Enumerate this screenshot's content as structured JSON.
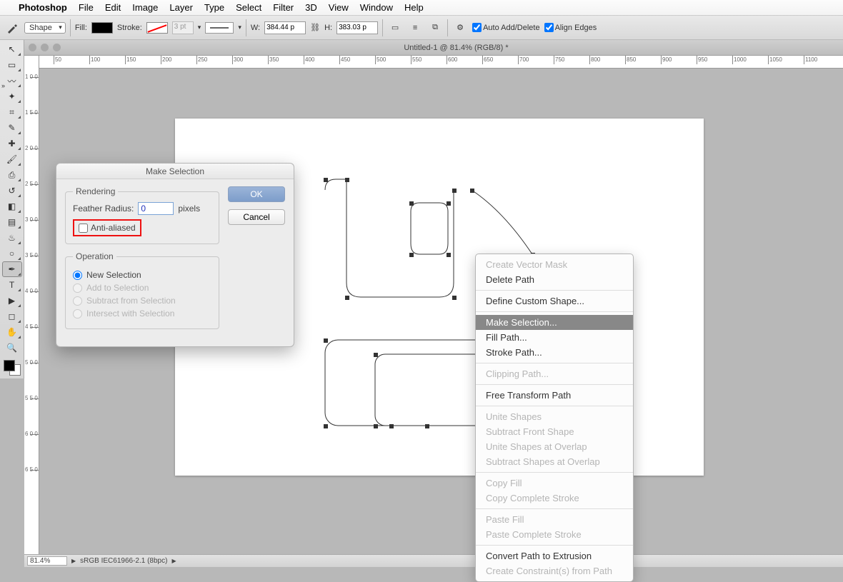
{
  "menubar": {
    "apple": "",
    "app": "Photoshop",
    "items": [
      "File",
      "Edit",
      "Image",
      "Layer",
      "Type",
      "Select",
      "Filter",
      "3D",
      "View",
      "Window",
      "Help"
    ]
  },
  "optbar": {
    "mode": "Shape",
    "fill_label": "Fill:",
    "stroke_label": "Stroke:",
    "stroke_w": "3 pt",
    "w_label": "W:",
    "w_val": "384.44 p",
    "h_label": "H:",
    "h_val": "383.03 p",
    "auto_add": "Auto Add/Delete",
    "align_edges": "Align Edges"
  },
  "tab": {
    "title": "Untitled-1 @ 81.4% (RGB/8) *"
  },
  "ruler_h": [
    "50",
    "100",
    "150",
    "200",
    "250",
    "300",
    "350",
    "400",
    "450",
    "500",
    "550",
    "600",
    "650",
    "700",
    "750",
    "800",
    "850",
    "900",
    "950",
    "1000",
    "1050",
    "1100"
  ],
  "ruler_v": [
    "100",
    "150",
    "200",
    "250",
    "300",
    "350",
    "400",
    "450",
    "500",
    "550",
    "600",
    "650"
  ],
  "status": {
    "zoom": "81.4%",
    "profile": "sRGB IEC61966-2.1 (8bpc)"
  },
  "ctx": {
    "items": [
      {
        "label": "Create Vector Mask",
        "dis": true
      },
      {
        "label": "Delete Path"
      },
      {
        "sep": true
      },
      {
        "label": "Define Custom Shape..."
      },
      {
        "sep": true
      },
      {
        "label": "Make Selection...",
        "hi": true
      },
      {
        "label": "Fill Path..."
      },
      {
        "label": "Stroke Path..."
      },
      {
        "sep": true
      },
      {
        "label": "Clipping Path...",
        "dis": true
      },
      {
        "sep": true
      },
      {
        "label": "Free Transform Path"
      },
      {
        "sep": true
      },
      {
        "label": "Unite Shapes",
        "dis": true
      },
      {
        "label": "Subtract Front Shape",
        "dis": true
      },
      {
        "label": "Unite Shapes at Overlap",
        "dis": true
      },
      {
        "label": "Subtract Shapes at Overlap",
        "dis": true
      },
      {
        "sep": true
      },
      {
        "label": "Copy Fill",
        "dis": true
      },
      {
        "label": "Copy Complete Stroke",
        "dis": true
      },
      {
        "sep": true
      },
      {
        "label": "Paste Fill",
        "dis": true
      },
      {
        "label": "Paste Complete Stroke",
        "dis": true
      },
      {
        "sep": true
      },
      {
        "label": "Convert Path to Extrusion"
      },
      {
        "label": "Create Constraint(s) from Path",
        "dis": true
      }
    ]
  },
  "dialog": {
    "title": "Make Selection",
    "rendering_legend": "Rendering",
    "feather_label": "Feather Radius:",
    "feather_val": "0",
    "feather_unit": "pixels",
    "aa_label": "Anti-aliased",
    "op_legend": "Operation",
    "ops": [
      "New Selection",
      "Add to Selection",
      "Subtract from Selection",
      "Intersect with Selection"
    ],
    "ok": "OK",
    "cancel": "Cancel"
  },
  "tools": [
    "move",
    "marquee",
    "lasso",
    "wand",
    "crop",
    "eyedropper",
    "heal",
    "brush",
    "stamp",
    "history",
    "eraser",
    "gradient",
    "blur",
    "dodge",
    "pen",
    "type",
    "path-select",
    "shape",
    "hand",
    "zoom"
  ]
}
